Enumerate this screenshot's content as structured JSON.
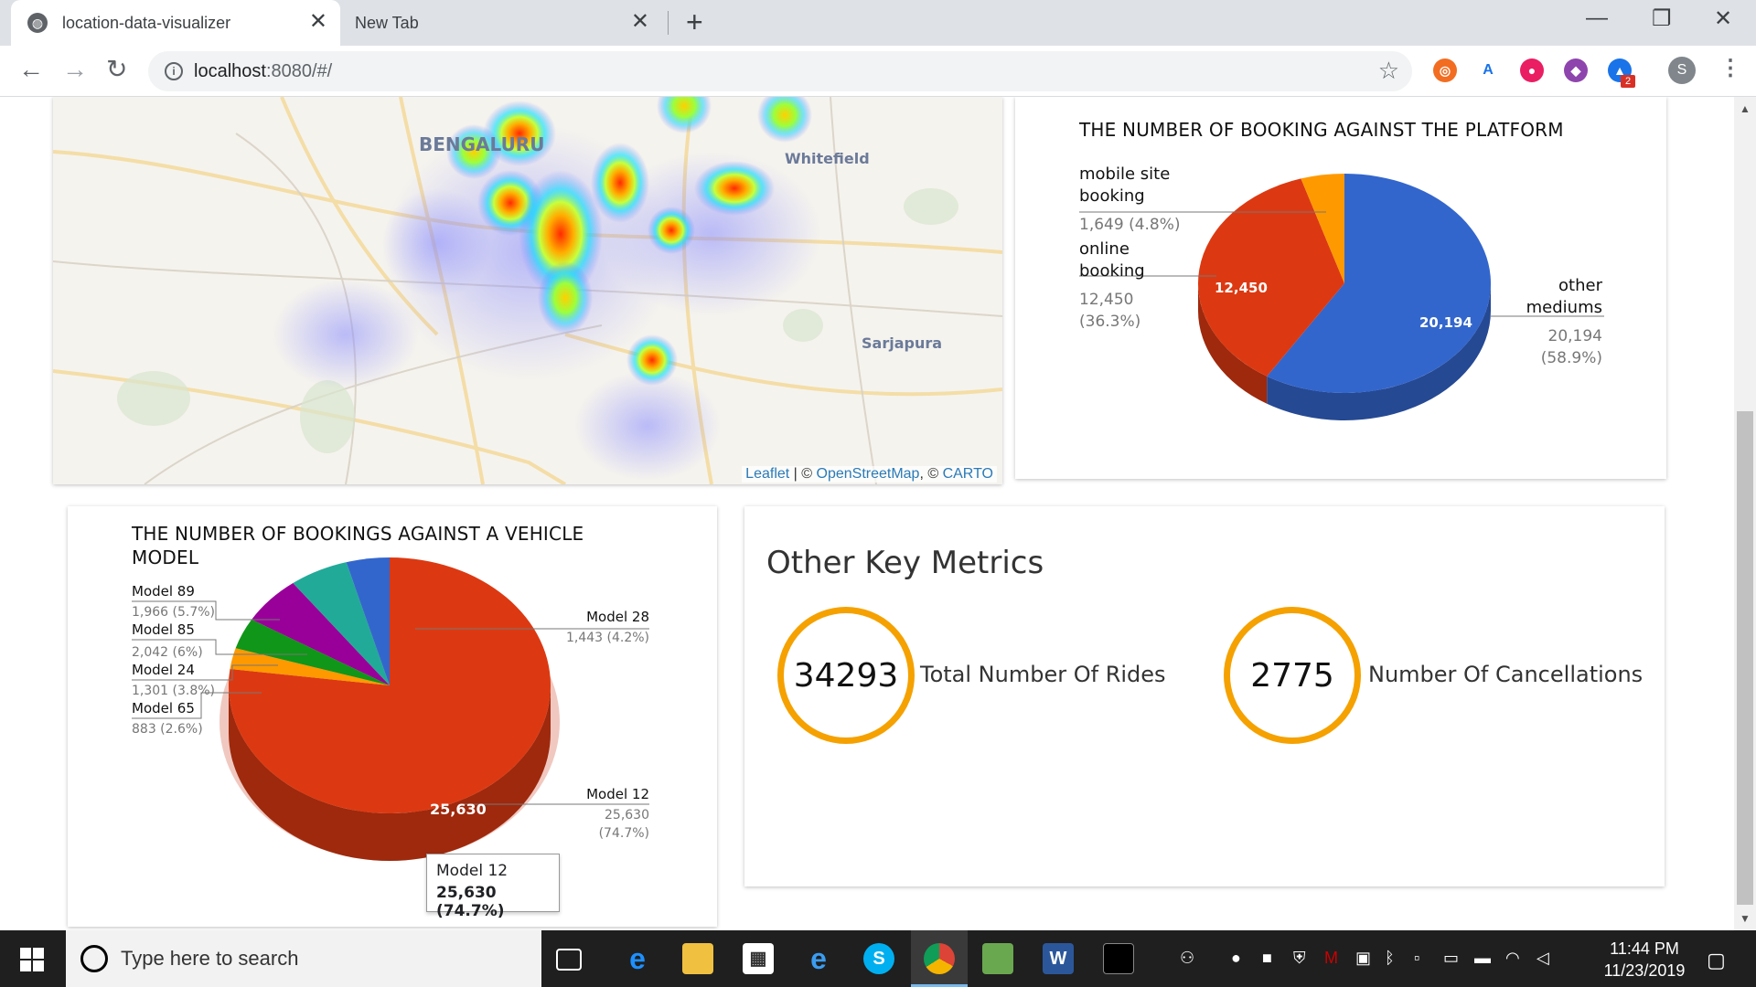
{
  "browser": {
    "tabs": [
      {
        "title": "location-data-visualizer",
        "active": true
      },
      {
        "title": "New Tab",
        "active": false
      }
    ],
    "url_host": "localhost",
    "url_rest": ":8080/#/",
    "extension_badge": "2",
    "profile_initial": "S"
  },
  "map": {
    "labels": {
      "city": "BENGALURU",
      "east": "Whitefield",
      "south": "Sarjapura"
    },
    "attribution": {
      "leaflet": "Leaflet",
      "sep1": " | © ",
      "osm": "OpenStreetMap",
      "sep2": ", © ",
      "carto": "CARTO"
    }
  },
  "platform_chart": {
    "title": "THE NUMBER OF BOOKING AGAINST THE PLATFORM",
    "chart_data": {
      "type": "pie",
      "title": "THE NUMBER OF BOOKING AGAINST THE PLATFORM",
      "categories": [
        "other mediums",
        "online booking",
        "mobile site booking"
      ],
      "values": [
        20194,
        12450,
        1649
      ],
      "percentages": [
        58.9,
        36.3,
        4.8
      ],
      "colors": [
        "#3366cc",
        "#dc3912",
        "#ff9900"
      ]
    },
    "labels": {
      "mobile_line1": "mobile site",
      "mobile_line2": "booking",
      "mobile_val": "1,649 (4.8%)",
      "online_line1": "online",
      "online_line2": "booking",
      "online_val1": "12,450",
      "online_val2": "(36.3%)",
      "other_line1": "other",
      "other_line2": "mediums",
      "other_val1": "20,194",
      "other_val2": "(58.9%)",
      "inside_online": "12,450",
      "inside_other": "20,194"
    }
  },
  "vehicle_chart": {
    "title_line1": "THE NUMBER OF BOOKINGS AGAINST A VEHICLE",
    "title_line2": "MODEL",
    "chart_data": {
      "type": "pie",
      "title": "THE NUMBER OF BOOKINGS AGAINST A VEHICLE MODEL",
      "categories": [
        "Model 12",
        "Model 65",
        "Model 24",
        "Model 85",
        "Model 89",
        "Model 28"
      ],
      "values": [
        25630,
        883,
        1301,
        2042,
        1966,
        1443
      ],
      "percentages": [
        74.7,
        2.6,
        3.8,
        6,
        5.7,
        4.2
      ],
      "colors": [
        "#dc3912",
        "#ff9900",
        "#109618",
        "#990099",
        "#22aa99",
        "#3366cc"
      ]
    },
    "labels": {
      "m89": "Model 89",
      "m89v": "1,966 (5.7%)",
      "m85": "Model 85",
      "m85v": "2,042 (6%)",
      "m24": "Model 24",
      "m24v": "1,301 (3.8%)",
      "m65": "Model 65",
      "m65v": "883 (2.6%)",
      "m28": "Model 28",
      "m28v": "1,443 (4.2%)",
      "m12": "Model 12",
      "m12v1": "25,630",
      "m12v2": "(74.7%)",
      "inside_m12": "25,630"
    },
    "tooltip": {
      "title": "Model 12",
      "value": "25,630 (74.7%)"
    }
  },
  "metrics": {
    "title": "Other Key Metrics",
    "rides_value": "34293",
    "rides_label": "Total Number Of Rides",
    "cancel_value": "2775",
    "cancel_label": "Number Of Cancellations"
  },
  "taskbar": {
    "search_placeholder": "Type here to search",
    "time": "11:44 PM",
    "date": "11/23/2019"
  }
}
